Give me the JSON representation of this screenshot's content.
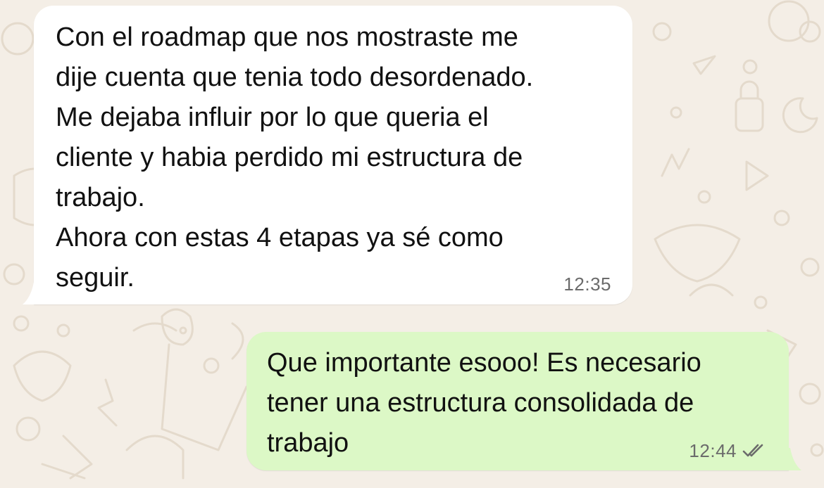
{
  "chat": {
    "messages": [
      {
        "direction": "incoming",
        "lines": [
          "Con el roadmap que nos mostraste me",
          "dije cuenta que tenia todo desordenado.",
          "Me dejaba influir por lo que queria el",
          "cliente y habia perdido mi estructura de",
          "trabajo.",
          "Ahora con estas 4 etapas ya sé como",
          "seguir."
        ],
        "time": "12:35"
      },
      {
        "direction": "outgoing",
        "lines": [
          "Que importante esooo! Es necesario",
          "tener una estructura consolidada de",
          "trabajo"
        ],
        "time": "12:44",
        "status_icon": "double-check-icon",
        "status_color": "#6b6b6b"
      }
    ]
  },
  "colors": {
    "background": "#f4eee6",
    "incoming_bubble": "#ffffff",
    "outgoing_bubble": "#dcf8c6",
    "doodle_stroke": "#e6ddd0"
  }
}
